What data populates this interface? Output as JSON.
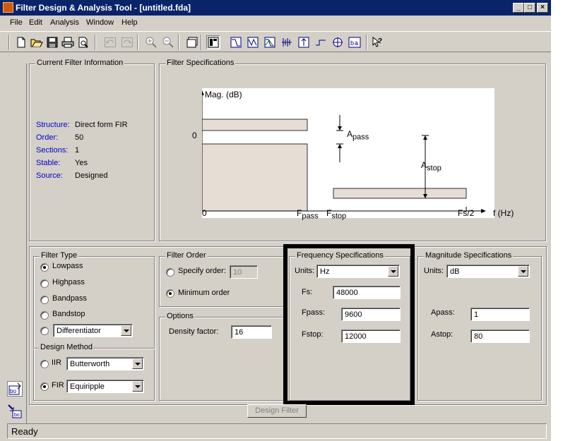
{
  "window": {
    "title": "Filter Design & Analysis Tool - [untitled.fda]",
    "controls": {
      "minimize": "_",
      "maximize": "□",
      "close": "×"
    }
  },
  "menu": [
    "File",
    "Edit",
    "Analysis",
    "Window",
    "Help"
  ],
  "toolbar": {
    "icons": [
      "new-icon",
      "open-icon",
      "save-icon",
      "print-icon",
      "print-preview-icon",
      "undo-icon",
      "redo-icon",
      "zoom-in-icon",
      "zoom-out-icon",
      "new-figure-icon",
      "full-view-icon",
      "magnitude-response-icon",
      "phase-response-icon",
      "magnitude-phase-icon",
      "group-delay-icon",
      "impulse-response-icon",
      "step-response-icon",
      "pole-zero-icon",
      "filter-coefficients-icon",
      "whats-this-icon"
    ]
  },
  "current_filter": {
    "title": "Current Filter Information",
    "rows": [
      {
        "key": "Structure:",
        "value": "Direct form FIR"
      },
      {
        "key": "Order:",
        "value": "50"
      },
      {
        "key": "Sections:",
        "value": "1"
      },
      {
        "key": "Stable:",
        "value": "Yes"
      },
      {
        "key": "Source:",
        "value": "Designed"
      }
    ]
  },
  "filter_specs": {
    "title": "Filter Specifications",
    "diagram": {
      "y_axis_label": "Mag. (dB)",
      "zero_label": "0",
      "apass_main": "A",
      "apass_sub": "pass",
      "astop_main": "A",
      "astop_sub": "stop",
      "x_zero": "0",
      "fpass_main": "F",
      "fpass_sub": "pass",
      "fstop_main": "F",
      "fstop_sub": "stop",
      "fs2": "Fs/2",
      "x_axis_label": "f (Hz)"
    }
  },
  "filter_type": {
    "title": "Filter Type",
    "options": [
      "Lowpass",
      "Highpass",
      "Bandpass",
      "Bandstop"
    ],
    "selected": "Lowpass",
    "differentiator": "Differentiator"
  },
  "design_method": {
    "title": "Design Method",
    "iir_label": "IIR",
    "iir_value": "Butterworth",
    "fir_label": "FIR",
    "fir_value": "Equiripple",
    "selected": "FIR"
  },
  "filter_order": {
    "title": "Filter Order",
    "specify_label": "Specify order:",
    "specify_value": "10",
    "minimum_label": "Minimum order",
    "selected": "Minimum order"
  },
  "options": {
    "title": "Options",
    "density_label": "Density factor:",
    "density_value": "16"
  },
  "frequency_specs": {
    "title": "Frequency Specifications",
    "units_label": "Units:",
    "units_value": "Hz",
    "fs_label": "Fs:",
    "fs_value": "48000",
    "fpass_label": "Fpass:",
    "fpass_value": "9600",
    "fstop_label": "Fstop:",
    "fstop_value": "12000"
  },
  "magnitude_specs": {
    "title": "Magnitude Specifications",
    "units_label": "Units:",
    "units_value": "dB",
    "apass_label": "Apass:",
    "apass_value": "1",
    "astop_label": "Astop:",
    "astop_value": "80"
  },
  "design_button": "Design Filter",
  "status": "Ready"
}
